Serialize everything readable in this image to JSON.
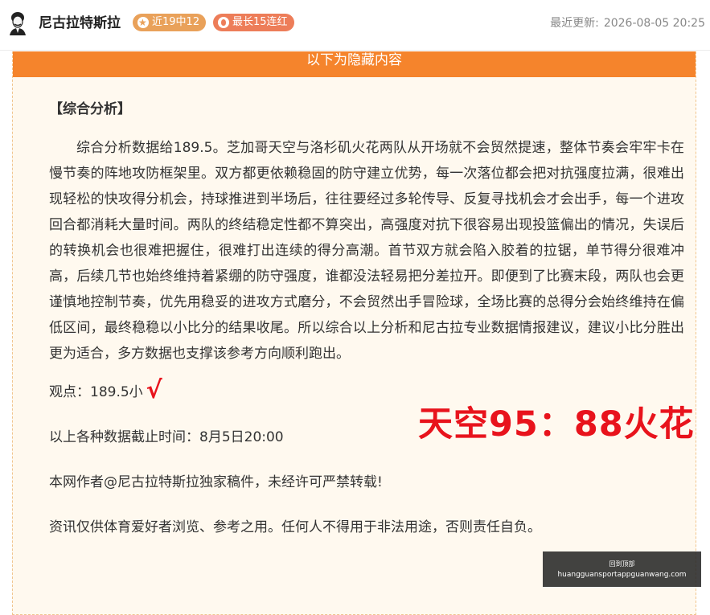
{
  "header": {
    "author_name": "尼古拉特斯拉",
    "badges": [
      {
        "label": "近19中12",
        "icon": "star-icon",
        "color": "#e9a15a"
      },
      {
        "label": "最长15连红",
        "icon": "flame-icon",
        "color": "#ed7d59"
      }
    ],
    "update_label": "最近更新:",
    "update_time": "2026-08-05 20:25"
  },
  "hidden_section": {
    "header_label": "以下为隐藏内容",
    "section_title": "【综合分析】",
    "analysis": "综合分析数据给189.5。芝加哥天空与洛杉矶火花两队从开场就不会贸然提速，整体节奏会牢牢卡在慢节奏的阵地攻防框架里。双方都更依赖稳固的防守建立优势，每一次落位都会把对抗强度拉满，很难出现轻松的快攻得分机会，持球推进到半场后，往往要经过多轮传导、反复寻找机会才会出手，每一个进攻回合都消耗大量时间。两队的终结稳定性都不算突出，高强度对抗下很容易出现投篮偏出的情况，失误后的转换机会也很难把握住，很难打出连续的得分高潮。首节双方就会陷入胶着的拉锯，单节得分很难冲高，后续几节也始终维持着紧绷的防守强度，谁都没法轻易把分差拉开。即便到了比赛末段，两队也会更谨慎地控制节奏，优先用稳妥的进攻方式磨分，不会贸然出手冒险球，全场比赛的总得分会始终维持在偏低区间，最终稳稳以小比分的结果收尾。所以综合以上分析和尼古拉专业数据情报建议，建议小比分胜出更为适合，多方数据也支撑该参考方向顺利跑出。",
    "prediction": "观点：189.5小",
    "check_mark": "√",
    "result": "天空95：88火花",
    "cutoff": "以上各种数据截止时间：8月5日20:00",
    "copyright": "本网作者@尼古拉特斯拉独家稿件，未经许可严禁转载!",
    "disclaimer": "资讯仅供体育爱好者浏览、参考之用。任何人不得用于非法用途，否则责任自负。"
  },
  "toast": {
    "title": "回到顶部",
    "url": "huangguansportappguanwang.com"
  },
  "colors": {
    "accent_orange": "#f5842c",
    "result_red": "#e8131c",
    "box_bg": "#fff9ef"
  }
}
